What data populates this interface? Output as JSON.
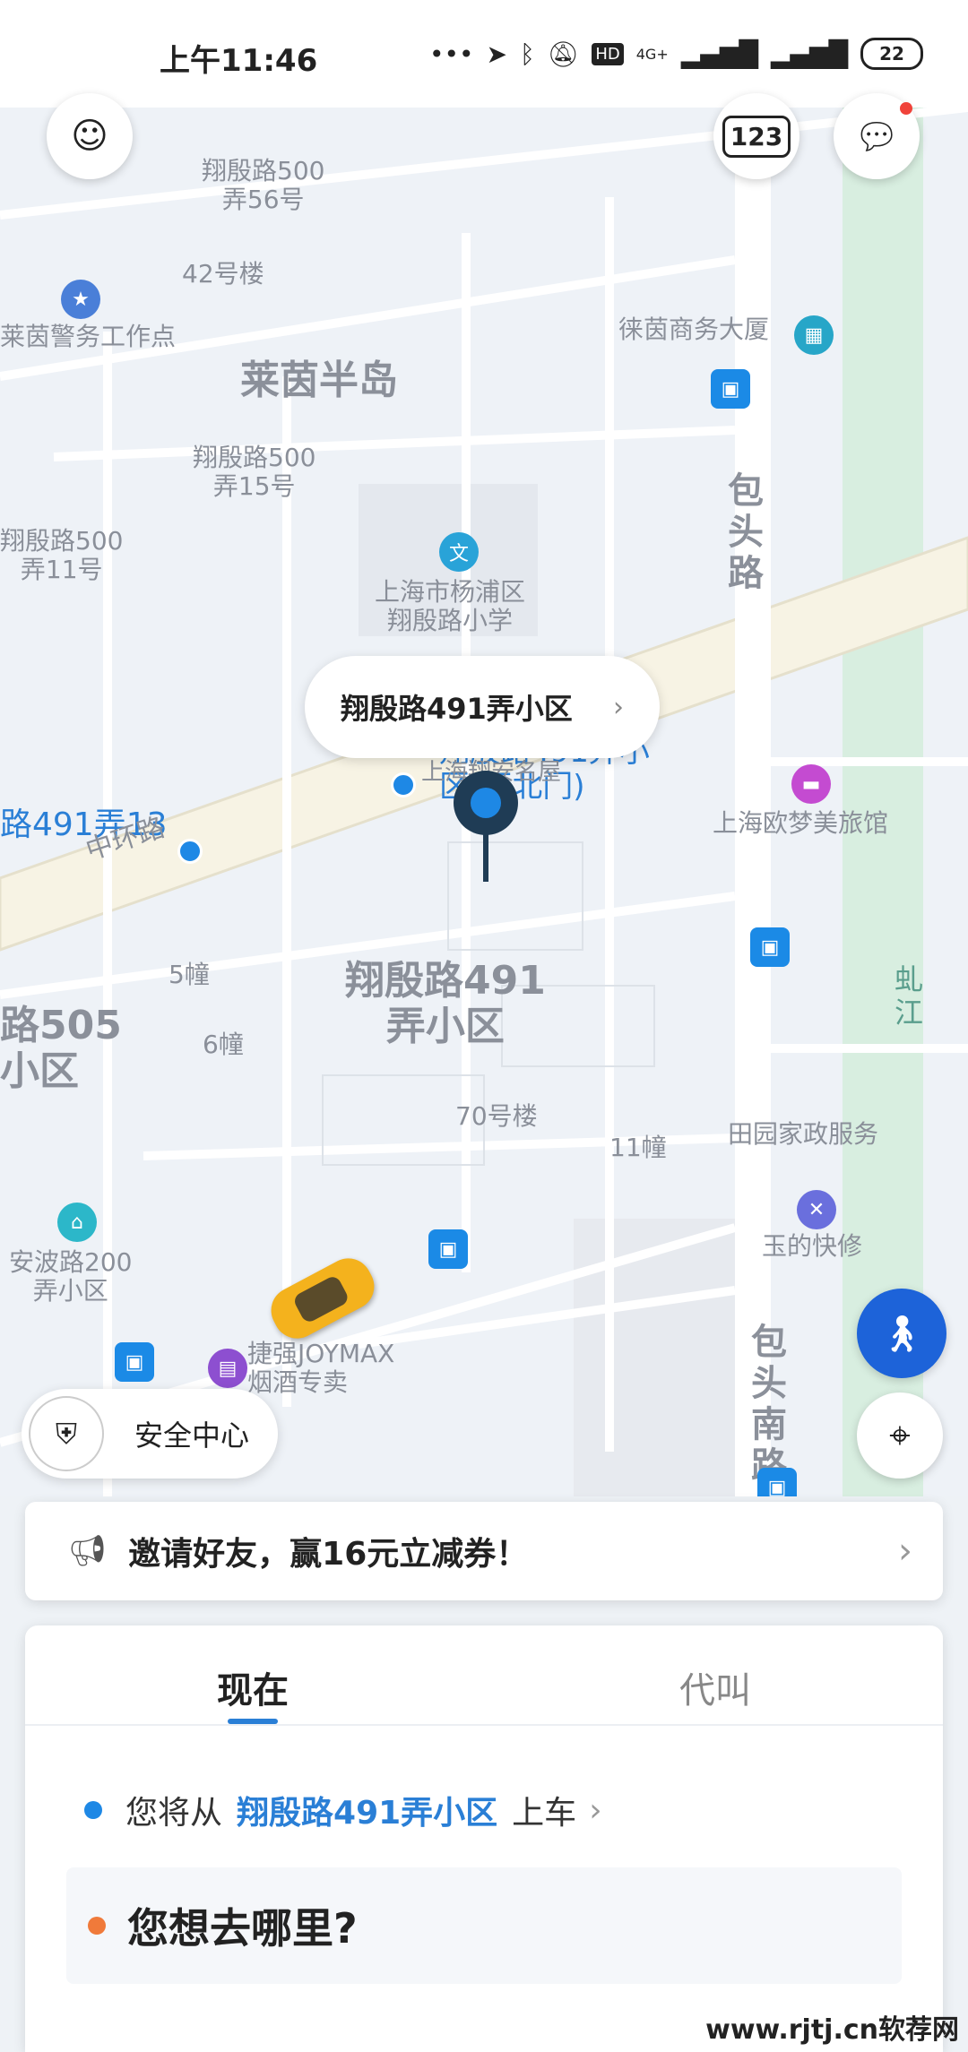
{
  "status_bar": {
    "time": "上午11:46",
    "signal_label": "4G+",
    "hd_label": "HD",
    "battery": "22"
  },
  "map": {
    "top_buttons": {
      "plate_label": "123"
    },
    "labels": {
      "l1": "翔殷路500\n弄56号",
      "l2": "42号楼",
      "l3": "莱茵警务工作点",
      "l4": "莱茵半岛",
      "l5": "翔殷路500\n弄15号",
      "l6": "翔殷路500\n弄11号",
      "l7": "上海市杨浦区\n翔殷路小学",
      "l8": "徕茵商务大厦",
      "l9": "包\n头\n路",
      "l10": "上海欧梦美旅馆",
      "l11": "路491弄13",
      "l12": "中环路",
      "l13": "5幢",
      "l14": "6幢",
      "l15": "翔殷路491\n弄小区",
      "l16": "路505\n小区",
      "l17": "70号楼",
      "l18": "11幢",
      "l19": "田园家政服务",
      "l20": "玉的快修",
      "l21": "安波路200\n弄小区",
      "l22": "捷强JOYMAX\n烟酒专卖",
      "l23": "包\n头\n南\n路",
      "l24": "虬\n江",
      "l25": "翔殷路491弄小\n区(西北门)",
      "l26": "上海翔安名屋"
    },
    "pickup_bubble": "翔殷路491弄小区",
    "safety_center": "安全中心"
  },
  "promo": {
    "text": "邀请好友，赢16元立减券！"
  },
  "booking": {
    "tabs": [
      "现在",
      "代叫"
    ],
    "active_tab": "现在",
    "pickup_prefix": "您将从",
    "pickup_place": "翔殷路491弄小区",
    "pickup_suffix": "上车",
    "destination_prompt": "您想去哪里?"
  },
  "watermark": "www.rjtj.cn软荐网",
  "colors": {
    "accent": "#2a7fd6",
    "destination_dot": "#f07a3a",
    "pickup_dot": "#1e88e5"
  }
}
